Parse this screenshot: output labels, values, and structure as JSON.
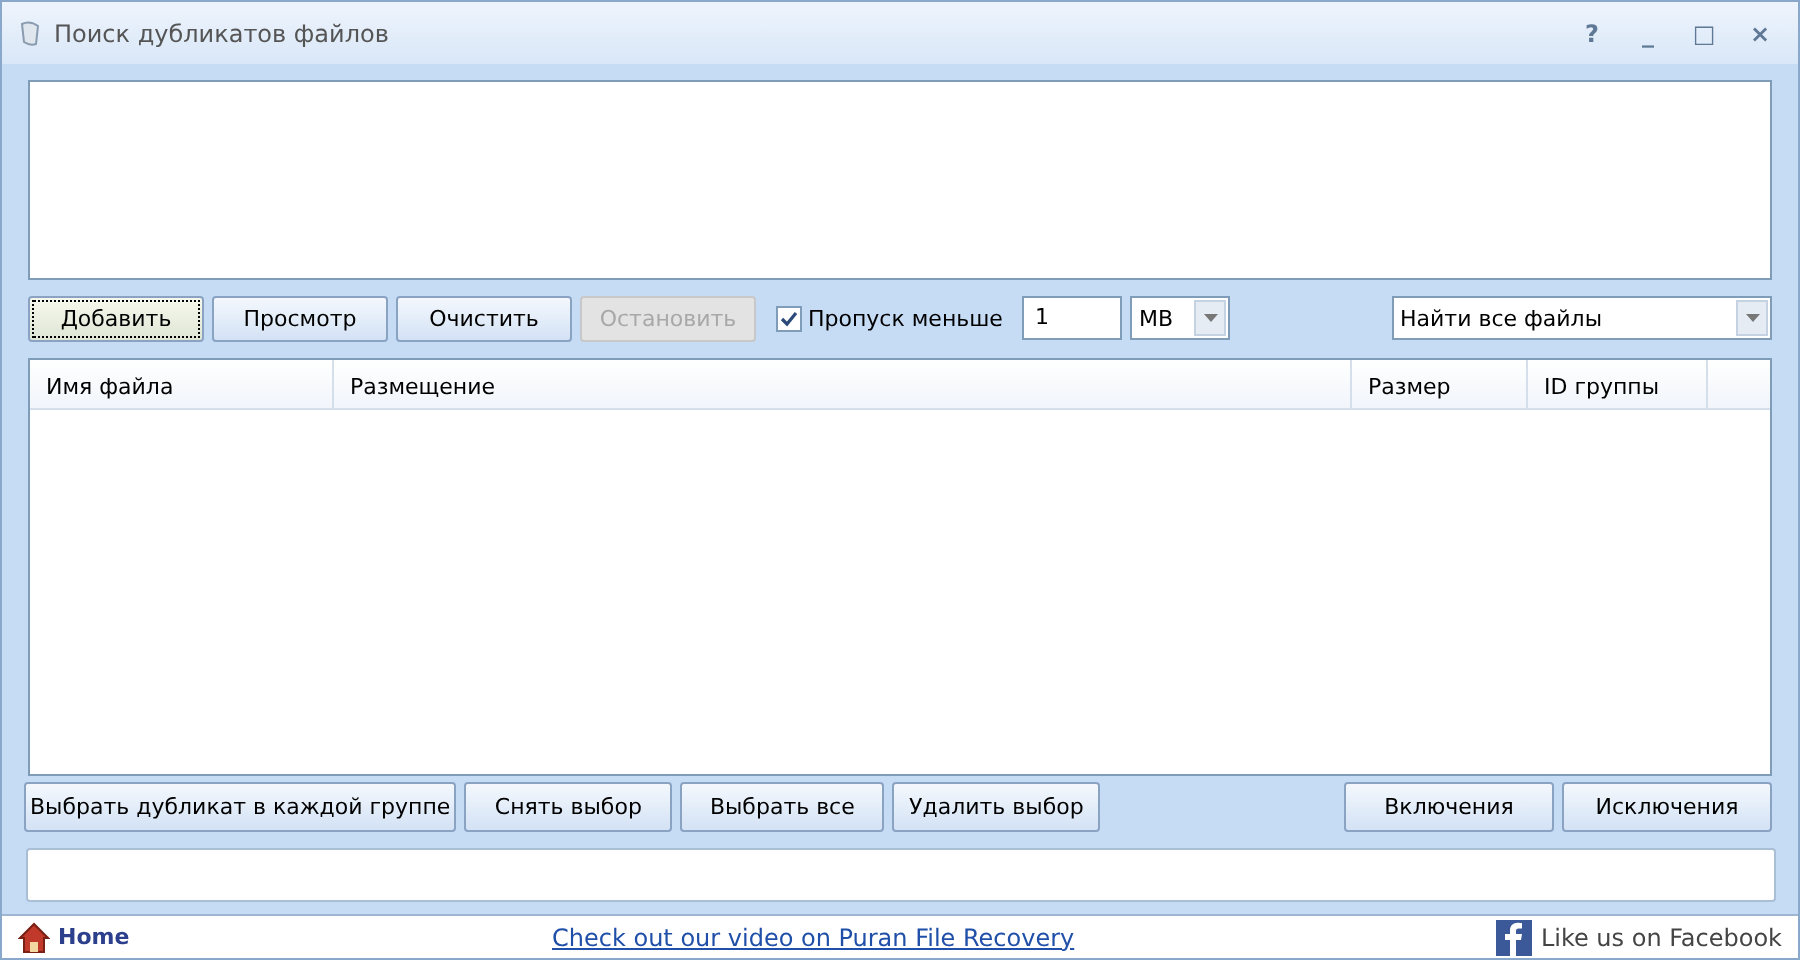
{
  "window": {
    "title": "Поиск дубликатов файлов",
    "controls": [
      "?",
      "_",
      "□",
      "×"
    ]
  },
  "toolbar": {
    "buttons": [
      {
        "label": "Добавить",
        "disabled": false,
        "focused": true
      },
      {
        "label": "Просмотр",
        "disabled": false,
        "focused": false
      },
      {
        "label": "Очистить",
        "disabled": false,
        "focused": false
      },
      {
        "label": "Остановить",
        "disabled": true,
        "focused": false
      }
    ],
    "skip_smaller": {
      "label": "Пропуск меньше",
      "checked": true
    },
    "size_value": "1",
    "size_unit": "MB",
    "mode": "Найти все файлы"
  },
  "table": {
    "columns": [
      "Имя файла",
      "Размещение",
      "Размер",
      "ID группы"
    ]
  },
  "actions_left": [
    "Выбрать дубликат в каждой группе",
    "Снять выбор",
    "Выбрать все",
    "Удалить выбор"
  ],
  "actions_right": [
    "Включения",
    "Исключения"
  ],
  "footer": {
    "home": "Home",
    "link": "Check out our video on Puran File Recovery",
    "facebook": "Like us on Facebook"
  }
}
